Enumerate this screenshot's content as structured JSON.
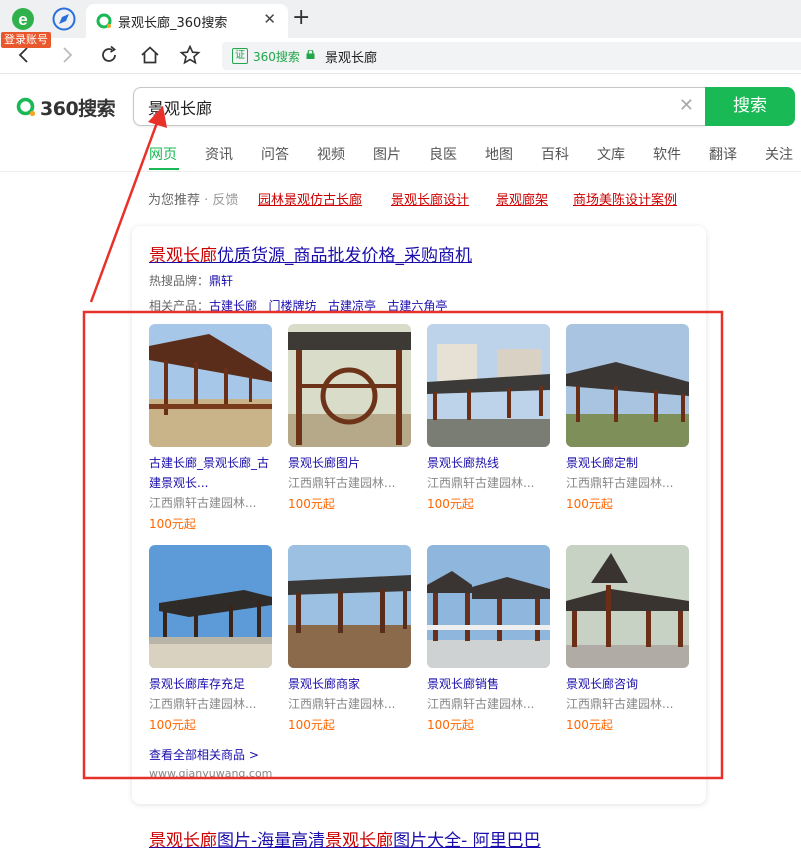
{
  "browser": {
    "tab_title": "景观长廊_360搜索",
    "login_badge": "登录账号",
    "address_brand": "360搜索",
    "address_cert": "证",
    "address_text": "景观长廊"
  },
  "search": {
    "logo_text": "360搜索",
    "query": "景观长廊",
    "button_label": "搜索"
  },
  "vertical_tabs": [
    "网页",
    "资讯",
    "问答",
    "视频",
    "图片",
    "良医",
    "地图",
    "百科",
    "文库",
    "软件",
    "翻译",
    "关注"
  ],
  "recommend": {
    "label": "为您推荐",
    "separator": " · ",
    "feedback": "反馈",
    "links": [
      "园林景观仿古长廊",
      "景观长廊设计",
      "景观廊架",
      "商场美陈设计案例"
    ]
  },
  "card": {
    "title_highlight": "景观长廊",
    "title_rest": "优质货源_商品批发价格_采购商机",
    "hot_brand_label": "热搜品牌：",
    "hot_brand": "鼎轩",
    "related_label": "相关产品：",
    "related": [
      "古建长廊",
      "门楼牌坊",
      "古建凉亭",
      "古建六角亭"
    ],
    "products": [
      {
        "name": "古建长廊_景观长廊_古建景观长...",
        "seller": "江西鼎轩古建园林...",
        "price": "100元起"
      },
      {
        "name": "景观长廊图片",
        "seller": "江西鼎轩古建园林...",
        "price": "100元起"
      },
      {
        "name": "景观长廊热线",
        "seller": "江西鼎轩古建园林...",
        "price": "100元起"
      },
      {
        "name": "景观长廊定制",
        "seller": "江西鼎轩古建园林...",
        "price": "100元起"
      },
      {
        "name": "景观长廊库存充足",
        "seller": "江西鼎轩古建园林...",
        "price": "100元起"
      },
      {
        "name": "景观长廊商家",
        "seller": "江西鼎轩古建园林...",
        "price": "100元起"
      },
      {
        "name": "景观长廊销售",
        "seller": "江西鼎轩古建园林...",
        "price": "100元起"
      },
      {
        "name": "景观长廊咨询",
        "seller": "江西鼎轩古建园林...",
        "price": "100元起"
      }
    ],
    "view_all": "查看全部相关商品 >",
    "source": "www.qianyuwang.com"
  },
  "result2": {
    "hl1": "景观长廊",
    "mid1": "图片-海量高清",
    "hl2": "景观长廊",
    "rest": "图片大全- 阿里巴巴"
  },
  "colors": {
    "accent": "#19b955",
    "link": "#1a0dab",
    "highlight": "#cc0000",
    "price": "#ff6600",
    "annotation": "#e8312a"
  }
}
